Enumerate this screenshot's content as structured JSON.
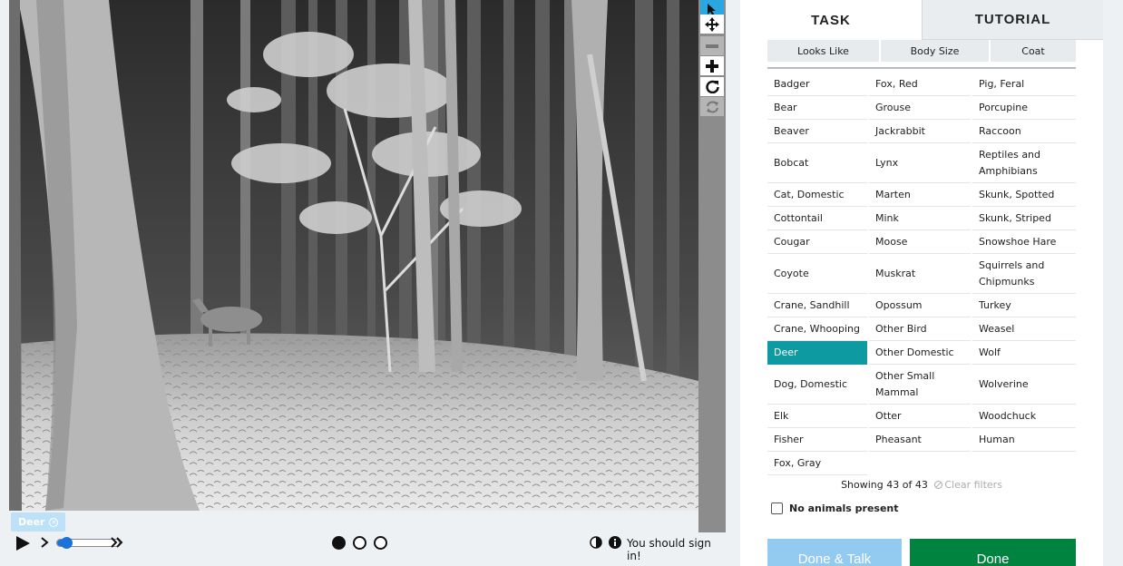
{
  "viewer": {
    "subject_tag": "Deer",
    "subject_tag_close_icon": "close-circle-icon",
    "tools": [
      "pointer-icon",
      "move-icon",
      "zoom-out-icon",
      "zoom-in-icon",
      "rotate-icon",
      "reset-icon"
    ],
    "active_tool": "pointer-icon",
    "frames": [
      {
        "label": "frame-1",
        "active": true
      },
      {
        "label": "frame-2",
        "active": false
      },
      {
        "label": "frame-3",
        "active": false
      }
    ],
    "playback_speed_fraction": 0.15,
    "signin_message": "You should sign in!"
  },
  "panel": {
    "tabs": [
      {
        "label": "TASK",
        "active": true
      },
      {
        "label": "TUTORIAL",
        "active": false
      }
    ],
    "filters": [
      "Looks Like",
      "Body Size",
      "Coat"
    ],
    "species_columns": [
      [
        "Badger",
        "Bear",
        "Beaver",
        "Bobcat",
        "Cat, Domestic",
        "Cottontail",
        "Cougar",
        "Coyote",
        "Crane, Sandhill",
        "Crane, Whooping",
        "Deer",
        "Dog, Domestic",
        "Elk",
        "Fisher",
        "Fox, Gray"
      ],
      [
        "Fox, Red",
        "Grouse",
        "Jackrabbit",
        "Lynx",
        "Marten",
        "Mink",
        "Moose",
        "Muskrat",
        "Opossum",
        "Other Bird",
        "Other Domestic",
        "Other Small Mammal",
        "Otter",
        "Pheasant"
      ],
      [
        "Pig, Feral",
        "Porcupine",
        "Raccoon",
        "Reptiles and Amphibians",
        "Skunk, Spotted",
        "Skunk, Striped",
        "Snowshoe Hare",
        "Squirrels and Chipmunks",
        "Turkey",
        "Weasel",
        "Wolf",
        "Wolverine",
        "Woodchuck",
        "Human"
      ]
    ],
    "selected_species": "Deer",
    "showing_text": "Showing 43 of 43",
    "clear_filters_label": "Clear filters",
    "no_animals_label": "No animals present",
    "done_talk_label": "Done & Talk",
    "done_label": "Done",
    "colors": {
      "selected": "#0d9aa0",
      "done": "#00833e",
      "done_talk": "#93cbf0",
      "active_tool": "#2aa7e0"
    }
  }
}
